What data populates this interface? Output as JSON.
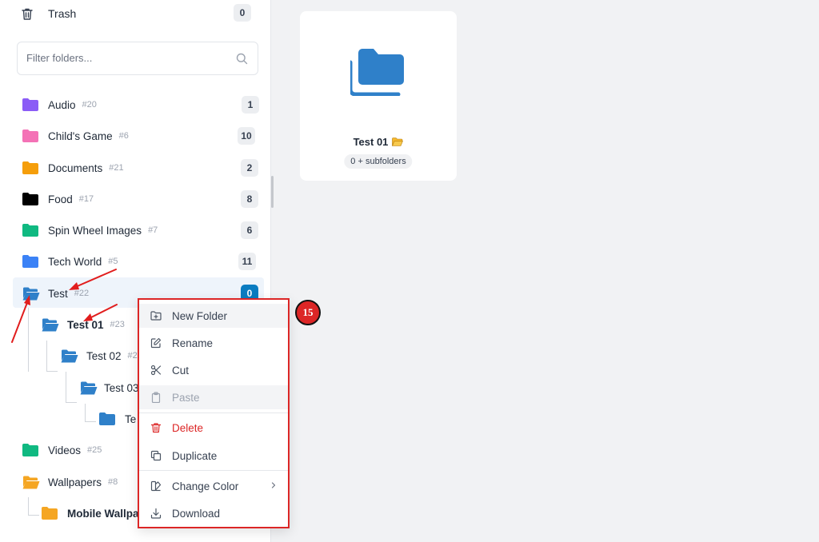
{
  "sidebar": {
    "trash": {
      "label": "Trash",
      "count": "0"
    },
    "filter": {
      "placeholder": "Filter folders..."
    },
    "folders": [
      {
        "name": "Audio",
        "id": "#20",
        "count": "1",
        "color": "#8b5cf6"
      },
      {
        "name": "Child's Game",
        "id": "#6",
        "count": "10",
        "color": "#f472b6"
      },
      {
        "name": "Documents",
        "id": "#21",
        "count": "2",
        "color": "#f59e0b"
      },
      {
        "name": "Food",
        "id": "#17",
        "count": "8",
        "color": "#000000"
      },
      {
        "name": "Spin Wheel Images",
        "id": "#7",
        "count": "6",
        "color": "#10b981"
      },
      {
        "name": "Tech World",
        "id": "#5",
        "count": "11",
        "color": "#3b82f6"
      },
      {
        "name": "Test",
        "id": "#22",
        "count": "0",
        "color": "#2f80c9"
      },
      {
        "name": "Test 01",
        "id": "#23",
        "color": "#2f80c9"
      },
      {
        "name": "Test 02",
        "id": "#2",
        "color": "#2f80c9"
      },
      {
        "name": "Test 03",
        "id": "",
        "color": "#2f80c9"
      },
      {
        "name": "Te",
        "id": "",
        "color": "#2f80c9"
      },
      {
        "name": "Videos",
        "id": "#25",
        "color": "#10b981"
      },
      {
        "name": "Wallpapers",
        "id": "#8",
        "color": "#f5a623"
      },
      {
        "name": "Mobile Wallpa",
        "id": "",
        "color": "#f5a623"
      }
    ]
  },
  "main": {
    "card": {
      "title": "Test 01",
      "subfolders": "0 + subfolders",
      "folder_color": "#2f80c9"
    }
  },
  "context_menu": {
    "items": [
      {
        "label": "New Folder",
        "icon": "folder-plus-icon"
      },
      {
        "label": "Rename",
        "icon": "pencil-icon"
      },
      {
        "label": "Cut",
        "icon": "scissors-icon"
      },
      {
        "label": "Paste",
        "icon": "clipboard-icon"
      },
      {
        "label": "Delete",
        "icon": "trash-icon"
      },
      {
        "label": "Duplicate",
        "icon": "copy-icon"
      },
      {
        "label": "Change Color",
        "icon": "palette-icon"
      },
      {
        "label": "Download",
        "icon": "download-icon"
      }
    ]
  },
  "annotation": {
    "step": "15"
  },
  "colors": {
    "accent": "#0a7cc1",
    "danger": "#dc2626"
  }
}
